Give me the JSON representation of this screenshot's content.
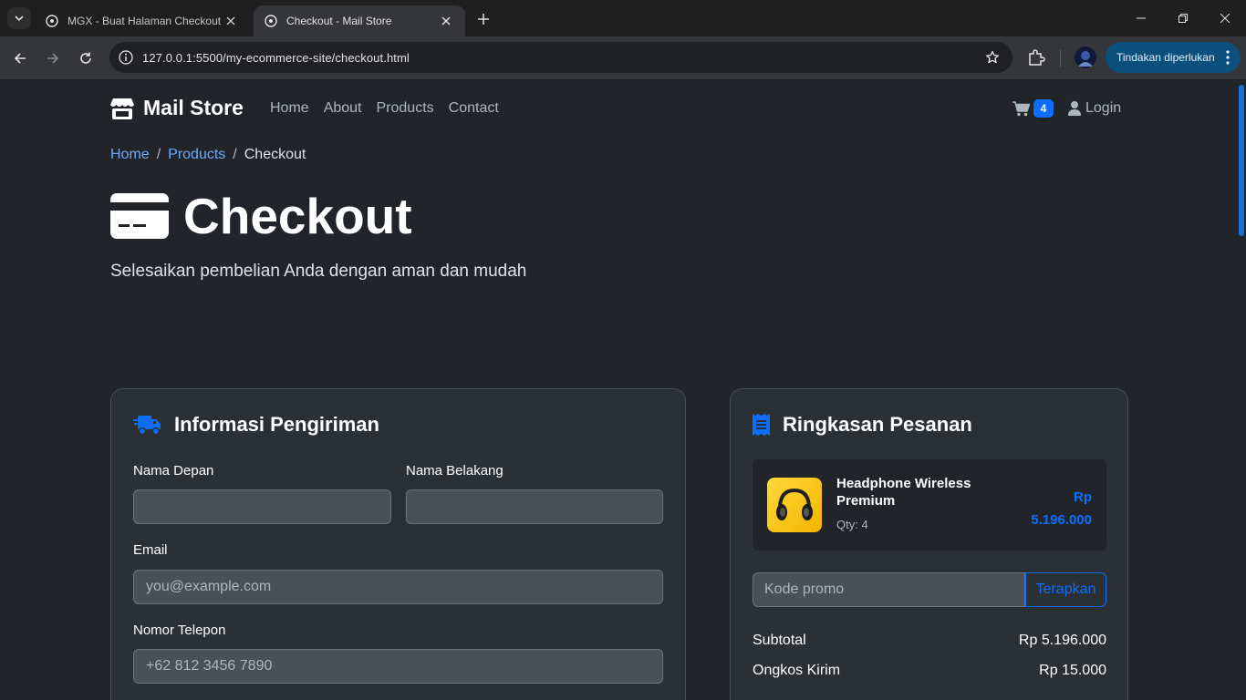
{
  "browser": {
    "tabs": [
      {
        "title": "MGX - Buat Halaman Checkout"
      },
      {
        "title": "Checkout - Mail Store"
      }
    ],
    "url": "127.0.0.1:5500/my-ecommerce-site/checkout.html",
    "action_label": "Tindakan diperlukan"
  },
  "navbar": {
    "brand": "Mail Store",
    "links": [
      "Home",
      "About",
      "Products",
      "Contact"
    ],
    "cart_count": "4",
    "login": "Login"
  },
  "breadcrumb": {
    "items": [
      "Home",
      "Products"
    ],
    "divider": "/",
    "current": "Checkout"
  },
  "hero": {
    "title": "Checkout",
    "subtitle": "Selesaikan pembelian Anda dengan aman dan mudah"
  },
  "shipping": {
    "title": "Informasi Pengiriman",
    "first_name_label": "Nama Depan",
    "last_name_label": "Nama Belakang",
    "email_label": "Email",
    "email_placeholder": "you@example.com",
    "phone_label": "Nomor Telepon",
    "phone_placeholder": "+62 812 3456 7890"
  },
  "summary": {
    "title": "Ringkasan Pesanan",
    "item": {
      "name": "Headphone Wireless Premium",
      "qty": "Qty: 4",
      "price_currency": "Rp",
      "price_value": "5.196.000"
    },
    "promo_placeholder": "Kode promo",
    "promo_button": "Terapkan",
    "subtotal_label": "Subtotal",
    "subtotal_value": "Rp 5.196.000",
    "shipping_label": "Ongkos Kirim",
    "shipping_value": "Rp 15.000"
  },
  "colors": {
    "accent": "#0d6efd",
    "background": "#212529",
    "card": "#2b3035"
  }
}
